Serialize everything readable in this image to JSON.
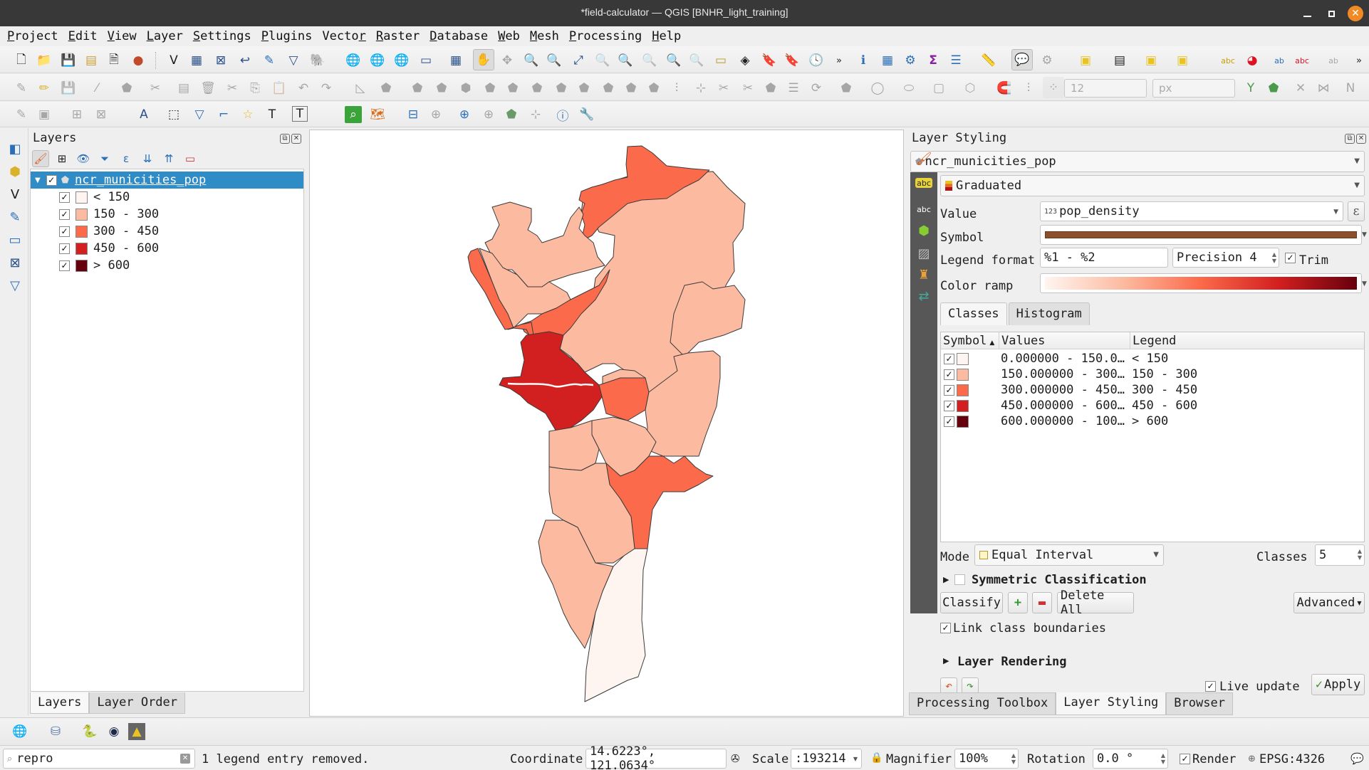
{
  "window": {
    "title": "*field-calculator — QGIS [BNHR_light_training]"
  },
  "menu": [
    "Project",
    "Edit",
    "View",
    "Layer",
    "Settings",
    "Plugins",
    "Vector",
    "Raster",
    "Database",
    "Web",
    "Mesh",
    "Processing",
    "Help"
  ],
  "menu_mnemonic_index": [
    0,
    0,
    0,
    0,
    0,
    0,
    5,
    0,
    0,
    0,
    0,
    0,
    0
  ],
  "toolbar": {
    "snapping_tolerance": "12",
    "snapping_units": "px",
    "overflow": "»"
  },
  "layers_panel": {
    "title": "Layers",
    "layer": {
      "name": "ncr_municities_pop",
      "checked": true,
      "expanded": true
    },
    "legend": [
      {
        "label": "< 150",
        "color": "#fff5f0",
        "checked": true
      },
      {
        "label": "150 - 300",
        "color": "#fcbba1",
        "checked": true
      },
      {
        "label": "300 - 450",
        "color": "#fb6a4a",
        "checked": true
      },
      {
        "label": "450 - 600",
        "color": "#d21f1f",
        "checked": true
      },
      {
        "label": "> 600",
        "color": "#67000d",
        "checked": true
      }
    ],
    "tabs": [
      "Layers",
      "Layer Order"
    ],
    "active_tab": "Layers"
  },
  "map": {
    "layer": "ncr_municities_pop",
    "stroke_color": "#3a3a3a"
  },
  "styling": {
    "title": "Layer Styling",
    "layer_select": "ncr_municities_pop",
    "renderer": "Graduated",
    "value_label": "Value",
    "value_field": "pop_density",
    "value_type_badge": "123",
    "symbol_label": "Symbol",
    "symbol_color": "#8b4f2c",
    "legend_format_label": "Legend format",
    "legend_format": "%1 - %2",
    "precision_label": "Precision 4",
    "trim_label": "Trim",
    "trim_checked": true,
    "color_ramp_label": "Color ramp",
    "color_ramp": [
      "#fff5f0",
      "#fcbba1",
      "#fb6a4a",
      "#d21f1f",
      "#67000d"
    ],
    "tabs": [
      "Classes",
      "Histogram"
    ],
    "active_tab": "Classes",
    "table_headers": [
      "Symbol",
      "Values",
      "Legend"
    ],
    "classes": [
      {
        "values": "0.000000 - 150.0…",
        "legend": "< 150",
        "color": "#fff5f0",
        "checked": true
      },
      {
        "values": "150.000000 - 300…",
        "legend": "150 - 300",
        "color": "#fcbba1",
        "checked": true
      },
      {
        "values": "300.000000 - 450…",
        "legend": "300 - 450",
        "color": "#fb6a4a",
        "checked": true
      },
      {
        "values": "450.000000 - 600…",
        "legend": "450 - 600",
        "color": "#d21f1f",
        "checked": true
      },
      {
        "values": "600.000000 - 100…",
        "legend": "> 600",
        "color": "#67000d",
        "checked": true
      }
    ],
    "mode_label": "Mode",
    "mode": "Equal Interval",
    "classes_label": "Classes",
    "classes_count": "5",
    "symmetric_label": "Symmetric Classification",
    "symmetric_checked": false,
    "classify_label": "Classify",
    "delete_all_label": "Delete All",
    "advanced_label": "Advanced",
    "link_boundaries_label": "Link class boundaries",
    "link_boundaries_checked": true,
    "layer_rendering_label": "Layer Rendering",
    "live_update_label": "Live update",
    "live_update_checked": true,
    "apply_label": "Apply"
  },
  "right_dock_tabs": [
    "Processing Toolbox",
    "Layer Styling",
    "Browser"
  ],
  "right_dock_active_tab": "Layer Styling",
  "status": {
    "search_value": "repro",
    "message": "1 legend entry removed.",
    "coordinate_label": "Coordinate",
    "coordinate": "14.6223°, 121.0634°",
    "scale_label": "Scale",
    "scale": ":193214",
    "magnifier_label": "Magnifier",
    "magnifier": "100%",
    "rotation_label": "Rotation",
    "rotation": "0.0 °",
    "render_label": "Render",
    "render_checked": true,
    "crs": "EPSG:4326"
  }
}
